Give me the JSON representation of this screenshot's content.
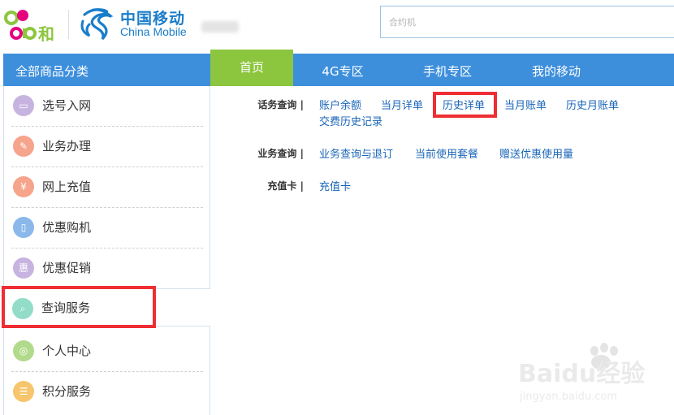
{
  "header": {
    "and_logo_text": "and和",
    "brand_cn": "中国移动",
    "brand_en": "China Mobile",
    "search_placeholder": "合约机"
  },
  "nav": {
    "category_title": "全部商品分类",
    "tabs": [
      {
        "label": "首页",
        "active": true
      },
      {
        "label": "4G专区",
        "active": false
      },
      {
        "label": "手机专区",
        "active": false
      },
      {
        "label": "我的移动",
        "active": false
      }
    ]
  },
  "sidebar": {
    "items": [
      {
        "label": "选号入网",
        "icon": "sim-card-icon",
        "icon_glyph": "▭",
        "color": "#c7b3e0"
      },
      {
        "label": "业务办理",
        "icon": "pencil-icon",
        "icon_glyph": "✎",
        "color": "#f6a48c"
      },
      {
        "label": "网上充值",
        "icon": "yen-icon",
        "icon_glyph": "¥",
        "color": "#f6a48c"
      },
      {
        "label": "优惠购机",
        "icon": "phone-icon",
        "icon_glyph": "▯",
        "color": "#8ab8ea"
      },
      {
        "label": "优惠促销",
        "icon": "hui-icon",
        "icon_glyph": "惠",
        "color": "#c7b3e0"
      },
      {
        "label": "查询服务",
        "icon": "search-icon",
        "icon_glyph": "⌕",
        "color": "#92dcc8"
      },
      {
        "label": "个人中心",
        "icon": "mouse-icon",
        "icon_glyph": "◎",
        "color": "#b2da8c"
      },
      {
        "label": "积分服务",
        "icon": "points-icon",
        "icon_glyph": "☰",
        "color": "#f6c56c"
      }
    ]
  },
  "content": {
    "rows": [
      {
        "label": "话务查询",
        "links": [
          "账户余额",
          "当月详单",
          "历史详单",
          "当月账单",
          "历史月账单",
          "交费历史记录"
        ]
      },
      {
        "label": "业务查询",
        "links": [
          "业务查询与退订",
          "当前使用套餐",
          "赠送优惠使用量"
        ]
      },
      {
        "label": "充值卡",
        "links": [
          "充值卡"
        ]
      }
    ]
  },
  "watermark": {
    "logo": "Baidu经验",
    "url": "jingyan.baidu.com"
  },
  "colors": {
    "nav_blue": "#3d8fdc",
    "active_green": "#8cc63f",
    "link_blue": "#1a66b8",
    "brand_blue": "#1a7dc9",
    "highlight_red": "#ee2e33"
  }
}
